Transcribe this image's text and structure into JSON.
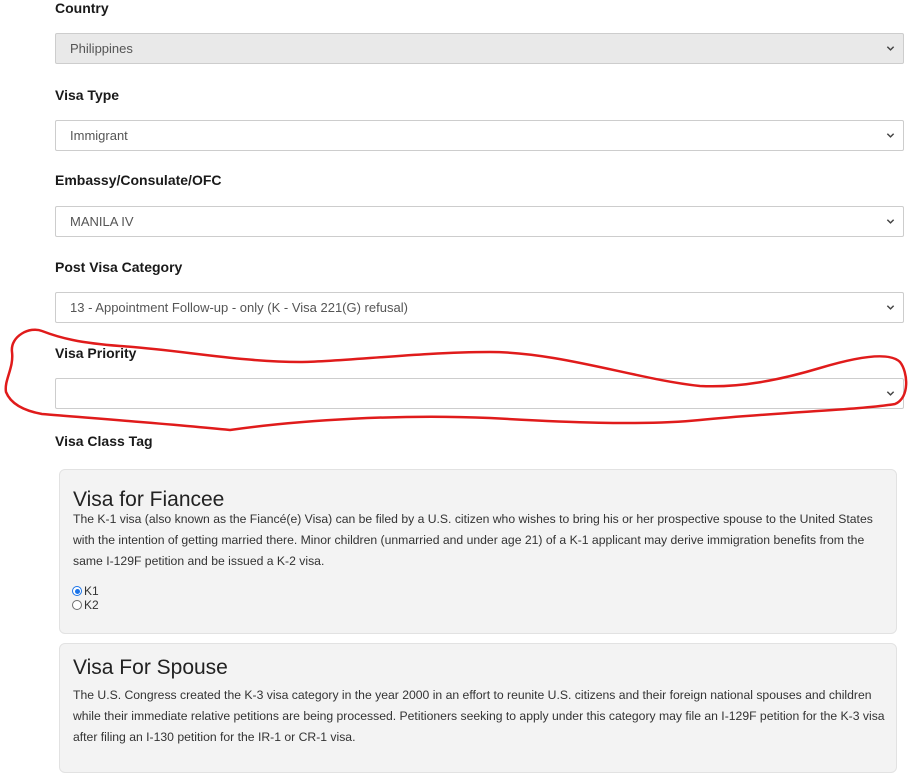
{
  "form": {
    "country": {
      "label": "Country",
      "value": "Philippines",
      "disabled": true
    },
    "visa_type": {
      "label": "Visa Type",
      "value": "Immigrant"
    },
    "embassy": {
      "label": "Embassy/Consulate/OFC",
      "value": "MANILA IV"
    },
    "post_visa_category": {
      "label": "Post Visa Category",
      "value": "13 - Appointment Follow-up - only (K - Visa 221(G) refusal)"
    },
    "visa_priority": {
      "label": "Visa Priority",
      "value": ""
    },
    "visa_class_tag": {
      "label": "Visa Class Tag"
    }
  },
  "cards": [
    {
      "title": "Visa for Fiancee",
      "body": "The K-1 visa (also known as the Fiancé(e) Visa) can be filed by a U.S. citizen who wishes to bring his or her prospective spouse to the United States with the intention of getting married there. Minor children (unmarried and under age 21) of a K-1 applicant may derive immigration benefits from the same I-129F petition and be issued a K-2 visa.",
      "options": [
        {
          "label": "K1",
          "checked": true
        },
        {
          "label": "K2",
          "checked": false
        }
      ]
    },
    {
      "title": "Visa For Spouse",
      "body": "The U.S. Congress created the K-3 visa category in the year 2000 in an effort to reunite U.S. citizens and their foreign national spouses and children while their immediate relative petitions are being processed. Petitioners seeking to apply under this category may file an I-129F petition for the K-3 visa after filing an I-130 petition for the IR-1 or CR-1 visa."
    }
  ],
  "colors": {
    "annotation": "#e01b1b",
    "radio_checked": "#1a73e8"
  }
}
